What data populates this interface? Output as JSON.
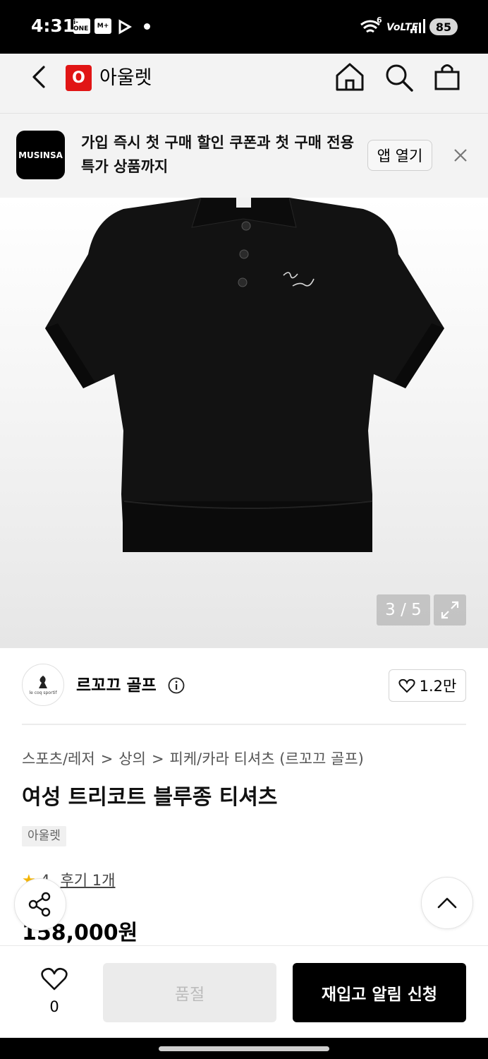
{
  "status_bar": {
    "time": "4:31",
    "icon_bank": "i-ONE Bank",
    "icon_2": "M+",
    "network": "VoLTE",
    "signal_label": "6",
    "battery": "85"
  },
  "header": {
    "logo_letter": "O",
    "title": "아울렛"
  },
  "banner": {
    "app_name": "MUSINSA",
    "text": "가입 즉시 첫 구매 할인 쿠폰과 첫 구매 전용 특가 상품까지",
    "open_app_label": "앱 열기"
  },
  "gallery": {
    "counter": "3 / 5"
  },
  "brand": {
    "name": "르꼬끄 골프",
    "logo_text": "le coq sportif",
    "likes": "1.2만"
  },
  "product": {
    "breadcrumb": [
      "스포츠/레저",
      "상의",
      "피케/카라 티셔츠 (르꼬끄 골프)"
    ],
    "title": "여성 트리코트 블루종 티셔츠",
    "tag": "아울렛",
    "rating": "4",
    "review_label": "후기 1개",
    "price": "158,000원"
  },
  "bottom_bar": {
    "wish_count": "0",
    "soldout_label": "품절",
    "restock_label": "재입고 알림 신청"
  },
  "colors": {
    "brand_red": "#e11515",
    "primary_black": "#000000"
  }
}
